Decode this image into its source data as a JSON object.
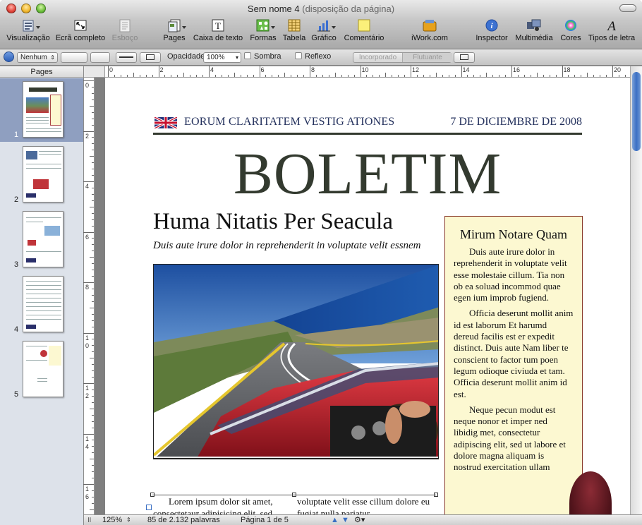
{
  "window": {
    "title": "Sem nome 4",
    "title_suffix": "(disposição da página)"
  },
  "toolbar": {
    "items": [
      {
        "label": "Visualização",
        "icon": "view-icon"
      },
      {
        "label": "Ecrã completo",
        "icon": "fullscreen-icon"
      },
      {
        "label": "Esboço",
        "icon": "outline-icon",
        "disabled": true
      },
      {
        "label": "Pages",
        "icon": "pages-icon"
      },
      {
        "label": "Caixa de texto",
        "icon": "textbox-icon"
      },
      {
        "label": "Formas",
        "icon": "shapes-icon"
      },
      {
        "label": "Tabela",
        "icon": "table-icon"
      },
      {
        "label": "Gráfico",
        "icon": "chart-icon"
      },
      {
        "label": "Comentário",
        "icon": "comment-icon"
      },
      {
        "label": "iWork.com",
        "icon": "iwork-icon"
      },
      {
        "label": "Inspector",
        "icon": "inspector-icon"
      },
      {
        "label": "Multimédia",
        "icon": "media-icon"
      },
      {
        "label": "Cores",
        "icon": "colors-icon"
      },
      {
        "label": "Tipos de letra",
        "icon": "fonts-icon"
      }
    ]
  },
  "formatbar": {
    "style_value": "Nenhum",
    "opacity_label": "Opacidade:",
    "opacity_value": "100%",
    "shadow_label": "Sombra",
    "reflection_label": "Reflexo",
    "inline_label": "Incorporado",
    "floating_label": "Flutuante"
  },
  "sidebar": {
    "header": "Pages",
    "pages": [
      "1",
      "2",
      "3",
      "4",
      "5"
    ],
    "selected": "1"
  },
  "ruler": {
    "top_ticks": [
      "0",
      "2",
      "4",
      "6",
      "8",
      "10",
      "12",
      "14",
      "16",
      "18",
      "20"
    ],
    "left_ticks": [
      "0",
      "2",
      "4",
      "6",
      "8",
      "1\n0",
      "1\n2",
      "1\n4",
      "1\n6"
    ]
  },
  "document": {
    "tagline": "EORUM CLARITATEM VESTIG ATIONES",
    "date": "7 DE DICIEMBRE DE 2008",
    "masthead": "BOLETIM",
    "headline": "Huma Nitatis Per Seacula",
    "subhead": "Duis aute irure dolor in reprehenderit in voluptate velit essnem",
    "sidebar_title": "Mirum Notare Quam",
    "sidebar_paragraphs": [
      "Duis aute irure dolor in reprehenderit in voluptate velit esse molestaie cillum. Tia non ob ea soluad incommod quae egen ium improb fugiend.",
      "Officia deserunt mollit anim id est laborum Et harumd dereud facilis est er expedit distinct. Duis aute Nam liber te conscient to factor tum poen legum odioque civiuda et tam. Officia deserunt mollit anim id est.",
      "Neque pecun modut est neque nonor et imper ned libidig met, consectetur adipiscing elit, sed ut labore et dolore magna aliquam is nostrud exercitation ullam"
    ],
    "col1_text": "Lorem ipsum dolor sit amet, consectetaur adipisicing elit, sed",
    "col2_text": "voluptate velit esse cillum dolore eu fugiat nulla pariatur."
  },
  "status": {
    "zoom": "125%",
    "words": "85 de 2.132 palavras",
    "page": "Página 1 de 5"
  }
}
